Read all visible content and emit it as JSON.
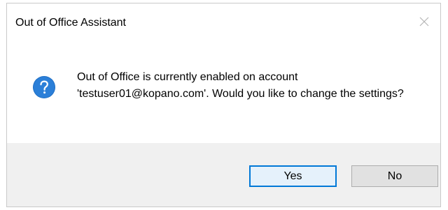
{
  "window": {
    "title": "Out of Office Assistant",
    "close_icon": "close-icon"
  },
  "message": {
    "icon": "question-icon",
    "text": "Out of Office is currently enabled on account 'testuser01@kopano.com'. Would you like to change the settings?"
  },
  "buttons": {
    "yes_label": "Yes",
    "no_label": "No"
  },
  "colors": {
    "accent": "#0078d7",
    "footer_bg": "#f0f0f0",
    "button_bg": "#e1e1e1"
  }
}
